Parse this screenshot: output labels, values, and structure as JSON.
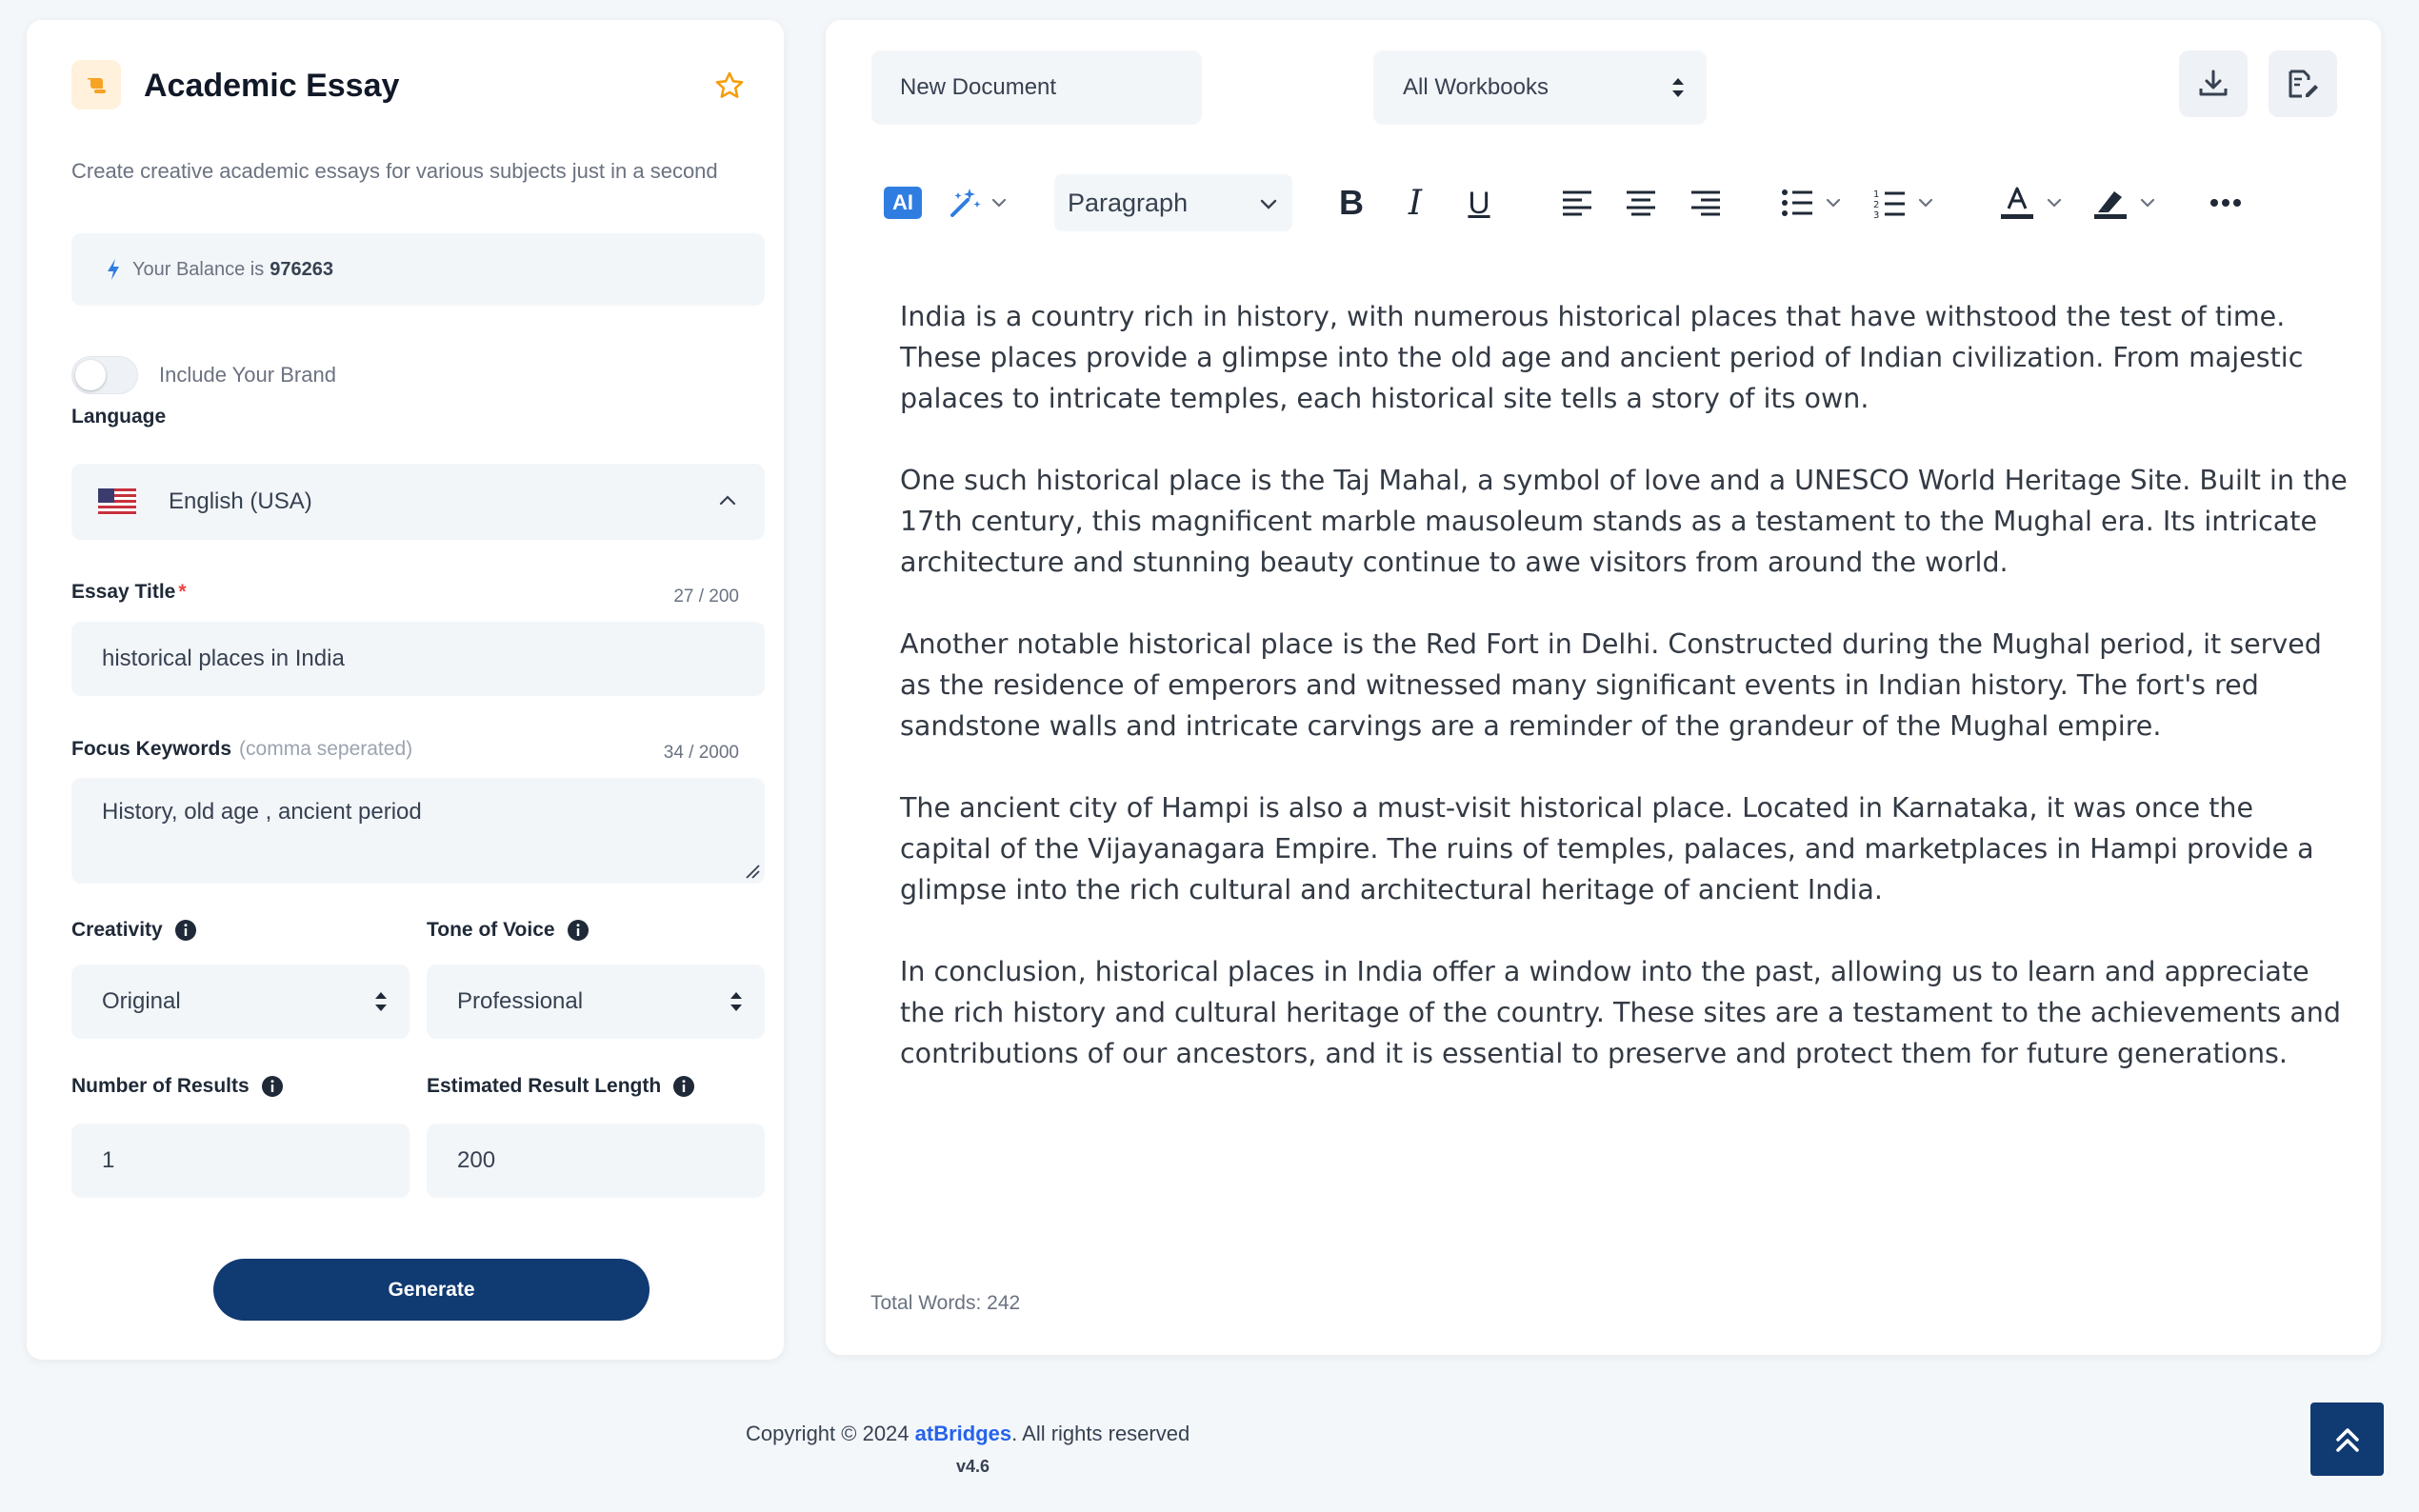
{
  "colors": {
    "primary": "#103a72",
    "accent_blue": "#2f7de1",
    "link_blue": "#2563eb",
    "required_red": "#ef4444",
    "star_orange": "#f59e0b",
    "logo_orange": "#f7a325",
    "input_bg": "#f3f6f9",
    "page_bg": "#f4f7fa"
  },
  "tool": {
    "icon": "scroll-icon",
    "title": "Academic Essay",
    "favorite_icon": "star-icon",
    "description": "Create creative academic essays for various subjects just in a second"
  },
  "balance": {
    "icon": "bolt-icon",
    "label": "Your Balance is",
    "value": "976263"
  },
  "brand_toggle": {
    "label": "Include Your Brand",
    "on": false
  },
  "language": {
    "label": "Language",
    "flag_icon": "us-flag-icon",
    "value": "English (USA)",
    "expanded": true
  },
  "essay_title": {
    "label": "Essay Title",
    "required_mark": "*",
    "counter": "27 / 200",
    "value": "historical places in India"
  },
  "focus_keywords": {
    "label": "Focus Keywords",
    "hint": "(comma seperated)",
    "counter": "34 / 2000",
    "value": "History, old age , ancient period"
  },
  "creativity": {
    "label": "Creativity",
    "value": "Original"
  },
  "tone": {
    "label": "Tone of Voice",
    "value": "Professional"
  },
  "num_results": {
    "label": "Number of Results",
    "value": "1"
  },
  "result_length": {
    "label": "Estimated Result Length",
    "value": "200"
  },
  "generate_label": "Generate",
  "editor": {
    "document_name": "New Document",
    "workbook": "All Workbooks",
    "actions": [
      "download-icon",
      "save-document-icon"
    ],
    "toolbar": {
      "ai_label": "AI",
      "block_format": "Paragraph",
      "bold": "B",
      "italic": "I",
      "underline": "U"
    },
    "paragraphs": [
      "India is a country rich in history, with numerous historical places that have withstood the test of time. These places provide a glimpse into the old age and ancient period of Indian civilization. From majestic palaces to intricate temples, each historical site tells a story of its own.",
      "One such historical place is the Taj Mahal, a symbol of love and a UNESCO World Heritage Site. Built in the 17th century, this magnificent marble mausoleum stands as a testament to the Mughal era. Its intricate architecture and stunning beauty continue to awe visitors from around the world.",
      "Another notable historical place is the Red Fort in Delhi. Constructed during the Mughal period, it served as the residence of emperors and witnessed many significant events in Indian history. The fort's red sandstone walls and intricate carvings are a reminder of the grandeur of the Mughal empire.",
      "The ancient city of Hampi is also a must-visit historical place. Located in Karnataka, it was once the capital of the Vijayanagara Empire. The ruins of temples, palaces, and marketplaces in Hampi provide a glimpse into the rich cultural and architectural heritage of ancient India.",
      "In conclusion, historical places in India offer a window into the past, allowing us to learn and appreciate the rich history and cultural heritage of the country. These sites are a testament to the achievements and contributions of our ancestors, and it is essential to preserve and protect them for future generations."
    ],
    "word_count": "Total Words: 242"
  },
  "footer": {
    "copyright_prefix": "Copyright © 2024",
    "brand": "atBridges",
    "copyright_suffix": ". All rights reserved",
    "version": "v4.6"
  }
}
